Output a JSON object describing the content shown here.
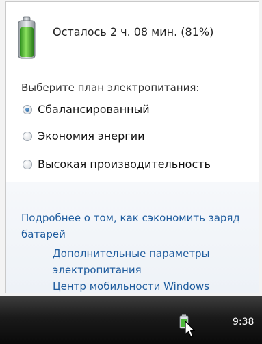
{
  "battery": {
    "status": "Осталось 2 ч. 08 мин. (81%)",
    "charge_level": 0.81,
    "accent": "#3fb52a"
  },
  "plans": {
    "prompt": "Выберите план электропитания:",
    "options": [
      {
        "label": "Сбалансированный",
        "selected": true
      },
      {
        "label": "Экономия энергии",
        "selected": false
      },
      {
        "label": "Высокая производительность",
        "selected": false
      }
    ]
  },
  "links": {
    "save_battery_line1": "Подробнее о том, как сэкономить заряд",
    "save_battery_line2": "батарей",
    "power_options_line1": "Дополнительные параметры",
    "power_options_line2": "электропитания",
    "mobility_center": "Центр мобильности Windows",
    "color": "#1f5c9e"
  },
  "taskbar": {
    "clock": "9:38",
    "tray_icon": "battery-icon"
  }
}
